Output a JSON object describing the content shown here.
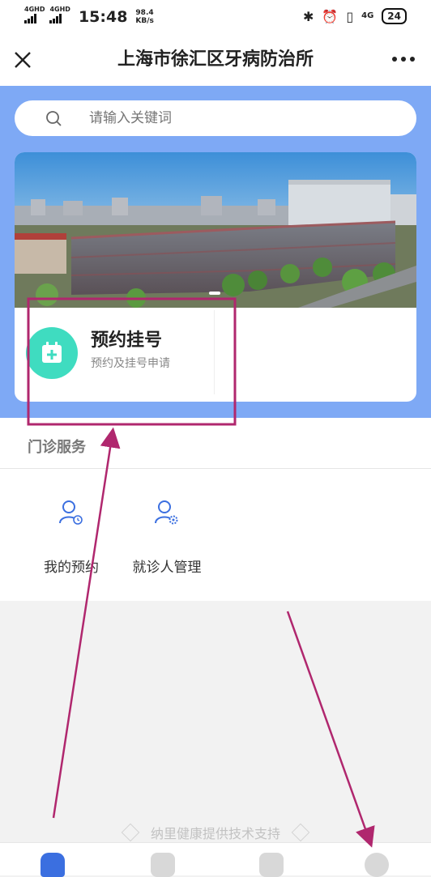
{
  "status_bar": {
    "signal_1": "4GHD",
    "signal_2": "4GHD",
    "time": "15:48",
    "speed_value": "98.4",
    "speed_unit": "KB/s",
    "network": "4G",
    "battery": "24"
  },
  "header": {
    "title": "上海市徐汇区牙病防治所"
  },
  "search": {
    "placeholder": "请输入关键词"
  },
  "service_card": {
    "title": "预约挂号",
    "subtitle": "预约及挂号申请"
  },
  "outpatient": {
    "section_title": "门诊服务",
    "items": [
      {
        "label": "我的预约",
        "icon": "user-clock-icon"
      },
      {
        "label": "就诊人管理",
        "icon": "user-gear-icon"
      }
    ]
  },
  "footer": {
    "support_text": "纳里健康提供技术支持"
  },
  "colors": {
    "header_blue": "#7ea9f5",
    "accent_blue": "#3b6fe0",
    "teal": "#3fdcc0",
    "annotation": "#b0276e"
  }
}
